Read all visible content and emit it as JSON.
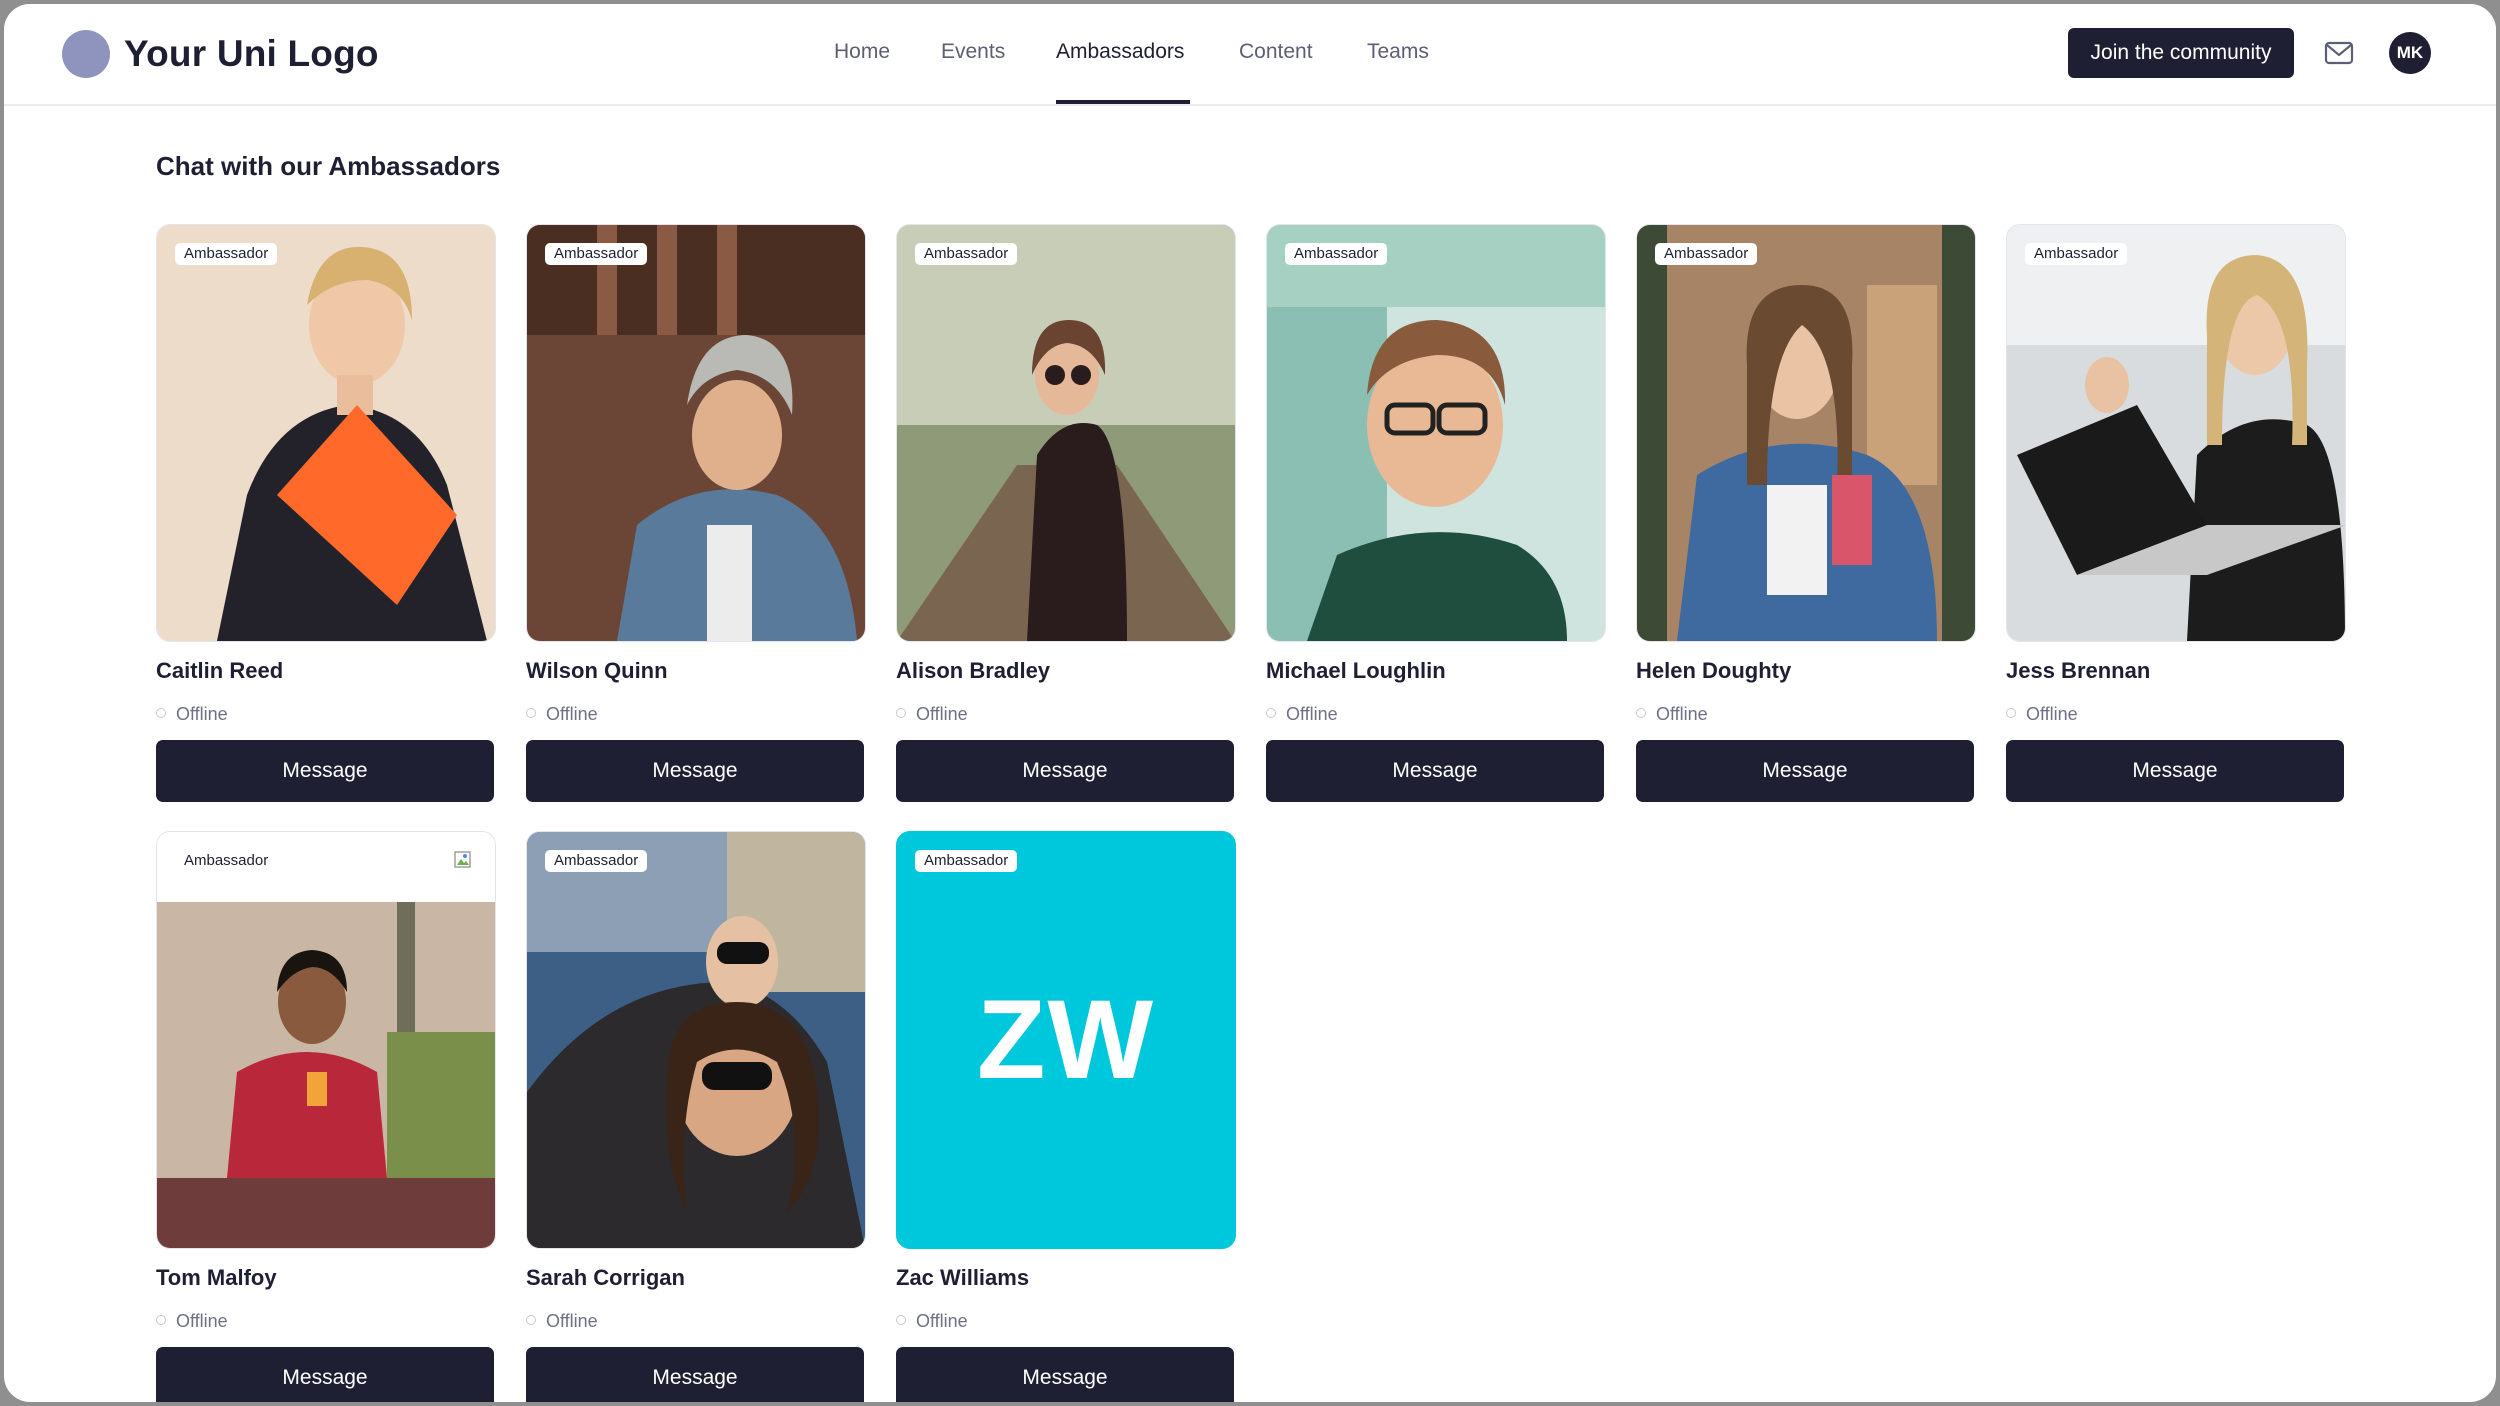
{
  "header": {
    "logo_text": "Your Uni Logo",
    "nav": [
      {
        "label": "Home"
      },
      {
        "label": "Events"
      },
      {
        "label": "Ambassadors",
        "active": true
      },
      {
        "label": "Content"
      },
      {
        "label": "Teams"
      }
    ],
    "join_label": "Join the community",
    "avatar_initials": "MK"
  },
  "main": {
    "title": "Chat with our Ambassadors",
    "badge_label": "Ambassador",
    "button_label": "Message",
    "ambassadors": [
      {
        "name": "Caitlin Reed",
        "status": "Offline",
        "photo": "photo"
      },
      {
        "name": "Wilson Quinn",
        "status": "Offline",
        "photo": "photo"
      },
      {
        "name": "Alison Bradley",
        "status": "Offline",
        "photo": "photo"
      },
      {
        "name": "Michael Loughlin",
        "status": "Offline",
        "photo": "photo"
      },
      {
        "name": "Helen Doughty",
        "status": "Offline",
        "photo": "photo"
      },
      {
        "name": "Jess Brennan",
        "status": "Offline",
        "photo": "photo"
      },
      {
        "name": "Tom Malfoy",
        "status": "Offline",
        "photo": "photo"
      },
      {
        "name": "Sarah Corrigan",
        "status": "Offline",
        "photo": "photo"
      },
      {
        "name": "Zac Williams",
        "status": "Offline",
        "initials": "ZW"
      }
    ]
  },
  "colors": {
    "primary": "#1e1f33",
    "logo_circle": "#8e94bd",
    "initials_tile": "#00c8dc"
  }
}
